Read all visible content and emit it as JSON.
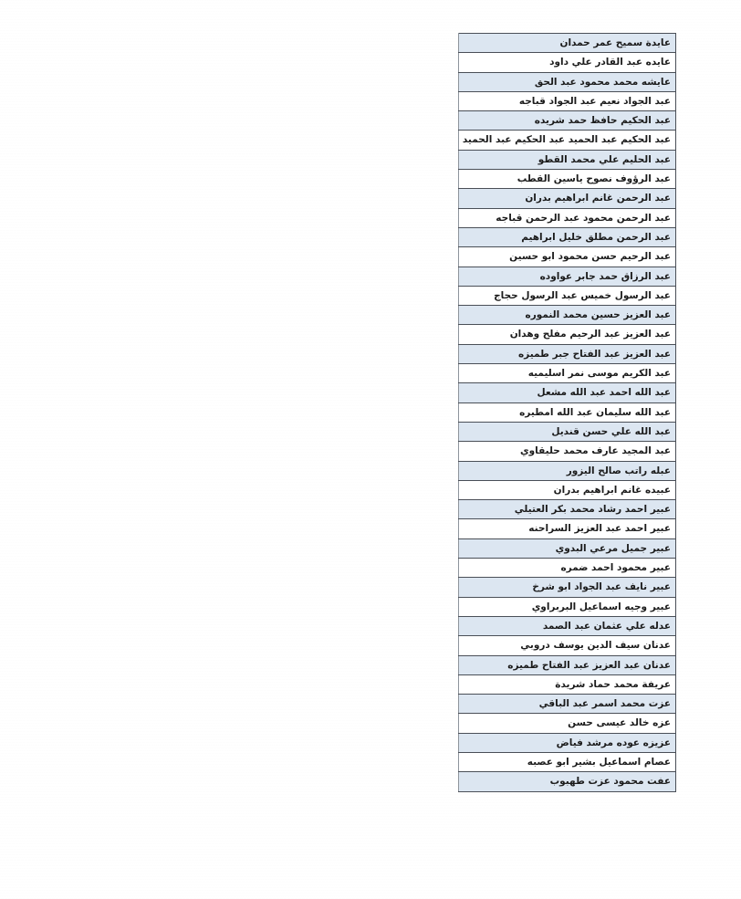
{
  "document": {
    "type": "scanned-table",
    "orientation": "rtl",
    "language": "Arabic",
    "page_background": "#ffffff",
    "table": {
      "column_count": 1,
      "row_count": 44,
      "shaded_row_color": "#dce6f1",
      "plain_row_color": "#ffffff",
      "border_color": "#4a4f57",
      "text_align": "right",
      "rows": [
        {
          "name": "عايدة سميح عمر حمدان",
          "shaded": true
        },
        {
          "name": "عايده عبد القادر علي داود",
          "shaded": false
        },
        {
          "name": "عايشه محمد محمود عبد الحق",
          "shaded": true
        },
        {
          "name": "عبد الجواد نعيم عبد الجواد قباجه",
          "shaded": false
        },
        {
          "name": "عبد الحكيم حافظ حمد شريده",
          "shaded": true
        },
        {
          "name": "عبد الحكيم عبد الحميد عبد الحكيم عبد الحميد",
          "shaded": false
        },
        {
          "name": "عبد الحليم علي محمد القطو",
          "shaded": true
        },
        {
          "name": "عبد الرؤوف نصوح ياسين القطب",
          "shaded": false
        },
        {
          "name": "عبد الرحمن غانم ابراهيم بدران",
          "shaded": true
        },
        {
          "name": "عبد الرحمن محمود عبد الرحمن قباجه",
          "shaded": false
        },
        {
          "name": "عبد الرحمن مطلق خليل ابراهيم",
          "shaded": true
        },
        {
          "name": "عبد الرحيم حسن محمود ابو حسين",
          "shaded": false
        },
        {
          "name": "عبد الرزاق حمد جابر عواوده",
          "shaded": true
        },
        {
          "name": "عبد الرسول خميس عبد الرسول حجاج",
          "shaded": false
        },
        {
          "name": "عبد العزيز حسين محمد النموره",
          "shaded": true
        },
        {
          "name": "عبد العزيز عبد الرحيم مفلح وهدان",
          "shaded": false
        },
        {
          "name": "عبد العزيز عبد الفتاح جبر طميزه",
          "shaded": true
        },
        {
          "name": "عبد الكريم موسى نمر اسليميه",
          "shaded": false
        },
        {
          "name": "عبد الله احمد عبد الله مشعل",
          "shaded": true
        },
        {
          "name": "عبد الله سليمان عبد الله امطيره",
          "shaded": false
        },
        {
          "name": "عبد الله علي حسن قنديل",
          "shaded": true
        },
        {
          "name": "عبد المجيد عارف محمد حليقاوي",
          "shaded": false
        },
        {
          "name": "عبله راتب صالح اليزور",
          "shaded": true
        },
        {
          "name": "عبيده غانم ابراهيم بدران",
          "shaded": false
        },
        {
          "name": "عبير احمد رشاد محمد بكر العتيلي",
          "shaded": true
        },
        {
          "name": "عبير احمد عبد العزيز السراحنه",
          "shaded": false
        },
        {
          "name": "عبير جميل مرعي البدوي",
          "shaded": true
        },
        {
          "name": "عبير محمود احمد ضمره",
          "shaded": false
        },
        {
          "name": "عبير نايف عبد الجواد ابو شرخ",
          "shaded": true
        },
        {
          "name": "عبير وجيه اسماعيل البربراوي",
          "shaded": false
        },
        {
          "name": "عدله علي عثمان عبد الصمد",
          "shaded": true
        },
        {
          "name": "عدنان سيف الدين يوسف دروبي",
          "shaded": false
        },
        {
          "name": "عدنان عبد العزيز عبد الفتاح طميزه",
          "shaded": true
        },
        {
          "name": "عريفة محمد حماد شريدة",
          "shaded": false
        },
        {
          "name": "عزت محمد اسمر عبد الباقي",
          "shaded": true
        },
        {
          "name": "عزه خالد عيسى حسن",
          "shaded": false
        },
        {
          "name": "عزيزه عوده مرشد فياض",
          "shaded": true
        },
        {
          "name": "عصام اسماعيل بشير ابو عصبه",
          "shaded": false
        },
        {
          "name": "عفت محمود عزت طهبوب",
          "shaded": true
        }
      ]
    }
  }
}
